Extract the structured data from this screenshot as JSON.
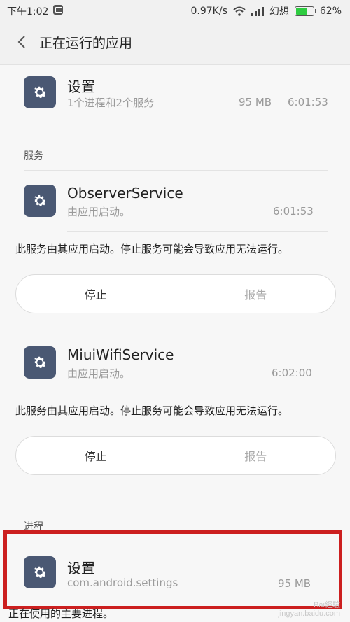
{
  "status_bar": {
    "time": "下午1:02",
    "speed": "0.97K/s",
    "carrier": "幻想",
    "battery": "62%",
    "battery_level": 0.62,
    "colors": {
      "battery_fill": "#2ecc40"
    }
  },
  "app_bar": {
    "title": "正在运行的应用",
    "back_icon": "chevron-left-icon"
  },
  "top_app": {
    "name": "设置",
    "subtitle": "1个进程和2个服务",
    "memory": "95 MB",
    "time": "6:01:53",
    "icon": "gear-icon"
  },
  "services": {
    "section_label": "服务",
    "items": [
      {
        "name": "ObserverService",
        "subtitle": "由应用启动。",
        "time": "6:01:53",
        "description": "此服务由其应用启动。停止服务可能会导致应用无法运行。",
        "stop_label": "停止",
        "report_label": "报告",
        "icon": "gear-icon"
      },
      {
        "name": "MiuiWifiService",
        "subtitle": "由应用启动。",
        "time": "6:02:00",
        "description": "此服务由其应用启动。停止服务可能会导致应用无法运行。",
        "stop_label": "停止",
        "report_label": "报告",
        "icon": "gear-icon"
      }
    ]
  },
  "processes": {
    "section_label": "进程",
    "items": [
      {
        "name": "设置",
        "subtitle": "com.android.settings",
        "memory": "95 MB",
        "icon": "gear-icon",
        "highlighted": true
      }
    ],
    "footer_text": "正在使用的主要进程。"
  },
  "watermark": {
    "line1": "Bai經驗",
    "line2": "jingyan.baidu.com"
  },
  "colors": {
    "highlight_border": "#cc1f1f",
    "app_icon_bg": "#4a5873"
  }
}
